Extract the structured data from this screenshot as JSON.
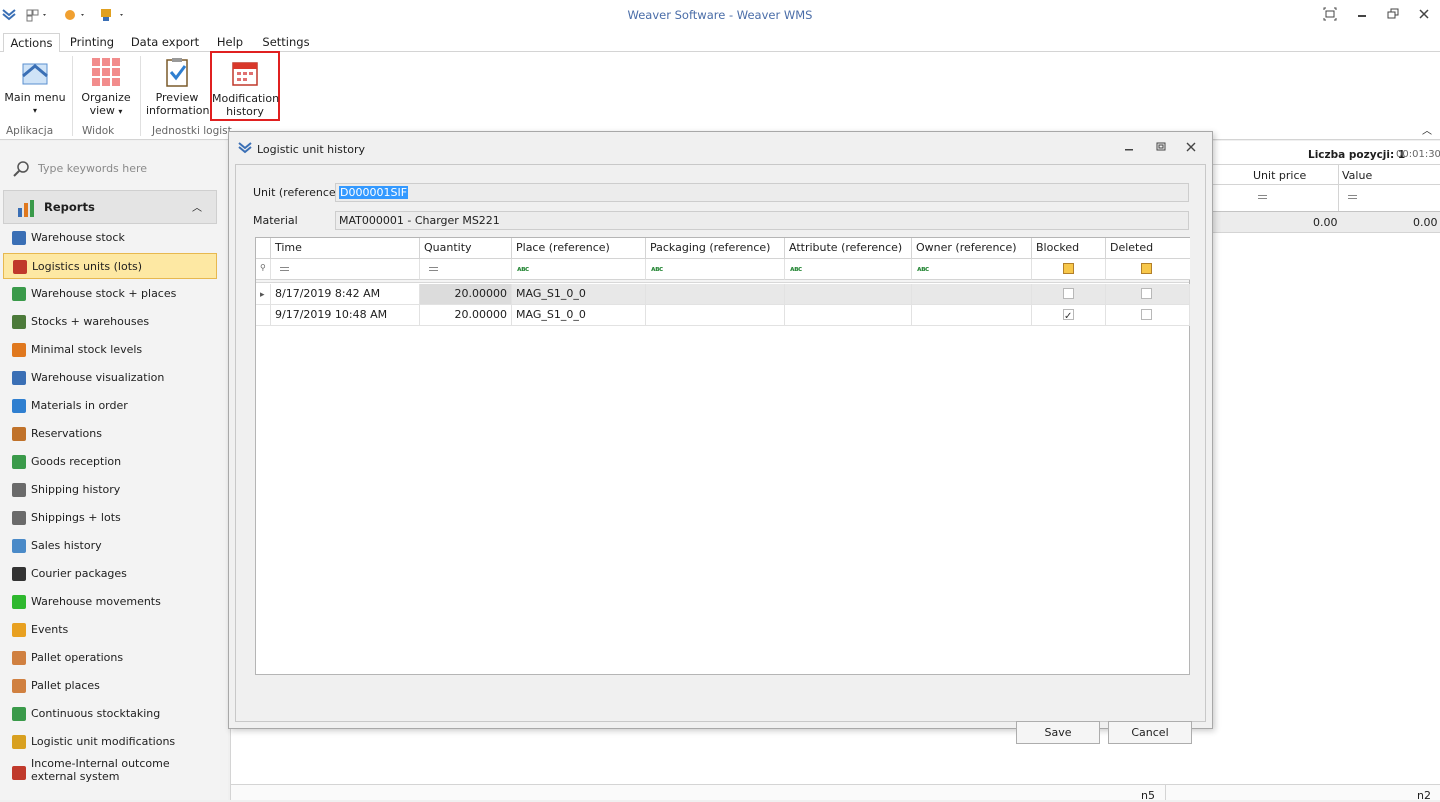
{
  "window": {
    "title": "Weaver Software - Weaver WMS"
  },
  "tabs": [
    "Actions",
    "Printing",
    "Data export",
    "Help",
    "Settings"
  ],
  "ribbon": {
    "buttons": [
      {
        "label1": "Main menu",
        "label2": ""
      },
      {
        "label1": "Organize",
        "label2": "view"
      },
      {
        "label1": "Preview",
        "label2": "information"
      },
      {
        "label1": "Modification",
        "label2": "history"
      }
    ],
    "groups": [
      "Aplikacja",
      "Widok",
      "Jednostki logist"
    ]
  },
  "sidebar": {
    "search_placeholder": "Type keywords here",
    "section": "Reports",
    "items": [
      {
        "label": "Warehouse stock",
        "icon": "warehouse-icon",
        "color": "#3a6fb5"
      },
      {
        "label": "Logistics units (lots)",
        "icon": "books-icon",
        "color": "#c0392b"
      },
      {
        "label": "Warehouse stock + places",
        "icon": "warehouse-green-icon",
        "color": "#3a9a4a"
      },
      {
        "label": "Stocks + warehouses",
        "icon": "truck-icon",
        "color": "#4c7a3a"
      },
      {
        "label": "Minimal stock levels",
        "icon": "down-arrow-icon",
        "color": "#e0781e"
      },
      {
        "label": "Warehouse visualization",
        "icon": "map-icon",
        "color": "#3a6fb5"
      },
      {
        "label": "Materials in order",
        "icon": "flag-icon",
        "color": "#2f7fd0"
      },
      {
        "label": "Reservations",
        "icon": "tag-icon",
        "color": "#c0722a"
      },
      {
        "label": "Goods reception",
        "icon": "truck-green-icon",
        "color": "#3a9a4a"
      },
      {
        "label": "Shipping history",
        "icon": "box-icon",
        "color": "#6a6a6a"
      },
      {
        "label": "Shippings + lots",
        "icon": "boxes-icon",
        "color": "#6a6a6a"
      },
      {
        "label": "Sales history",
        "icon": "ship-icon",
        "color": "#4a8ac8"
      },
      {
        "label": "Courier packages",
        "icon": "plane-icon",
        "color": "#333333"
      },
      {
        "label": "Warehouse movements",
        "icon": "right-arrow-icon",
        "color": "#2eb82e"
      },
      {
        "label": "Events",
        "icon": "lightning-icon",
        "color": "#e8a020"
      },
      {
        "label": "Pallet operations",
        "icon": "pallet-icon",
        "color": "#d08040"
      },
      {
        "label": "Pallet places",
        "icon": "pallet-place-icon",
        "color": "#d08040"
      },
      {
        "label": "Continuous stocktaking",
        "icon": "refresh-icon",
        "color": "#3a9a4a"
      },
      {
        "label": "Logistic unit modifications",
        "icon": "edit-icon",
        "color": "#d8a020"
      },
      {
        "label": "Income-Internal outcome external system",
        "icon": "exchange-icon",
        "color": "#c0392b"
      }
    ]
  },
  "right_panel": {
    "count_label": "Liczba pozycji: 1",
    "timer": "00:01:30",
    "columns": [
      "Unit price",
      "Value"
    ],
    "totals": [
      "0.00",
      "0.00"
    ],
    "footer": [
      "n5",
      "n2"
    ]
  },
  "dialog": {
    "title": "Logistic unit history",
    "unit_label": "Unit (reference)",
    "unit_value": "D000001SIF",
    "material_label": "Material",
    "material_value": "MAT000001 - Charger MS221",
    "columns": [
      "Time",
      "Quantity",
      "Place (reference)",
      "Packaging (reference)",
      "Attribute (reference)",
      "Owner (reference)",
      "Blocked",
      "Deleted"
    ],
    "rows": [
      {
        "time": "8/17/2019 8:42 AM",
        "quantity": "20.00000",
        "place": "MAG_S1_0_0",
        "blocked": false,
        "deleted": false
      },
      {
        "time": "9/17/2019 10:48 AM",
        "quantity": "20.00000",
        "place": "MAG_S1_0_0",
        "blocked": true,
        "deleted": false
      }
    ],
    "save_label": "Save",
    "cancel_label": "Cancel"
  }
}
